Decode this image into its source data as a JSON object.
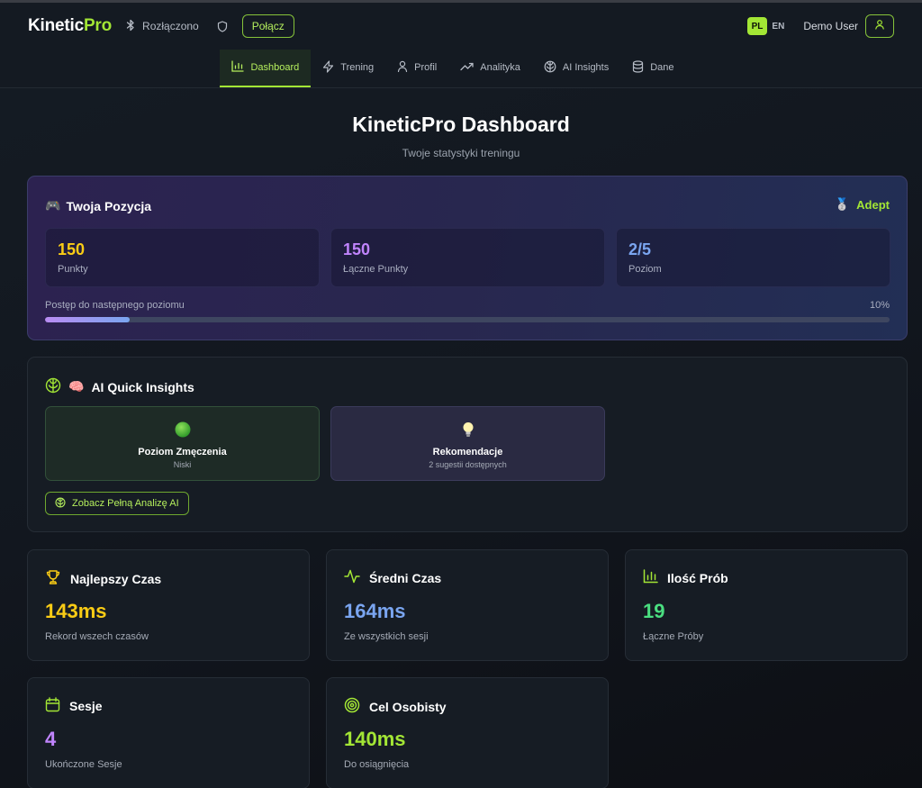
{
  "app": {
    "logo_main": "Kinetic",
    "logo_accent": "Pro"
  },
  "header": {
    "bluetooth_status": "Rozłączono",
    "connect_label": "Połącz",
    "languages": [
      "PL",
      "EN"
    ],
    "active_language": "PL",
    "user_name": "Demo User"
  },
  "nav": {
    "tabs": [
      {
        "label": "Dashboard",
        "icon": "bar-chart-icon",
        "active": true
      },
      {
        "label": "Trening",
        "icon": "lightning-icon"
      },
      {
        "label": "Profil",
        "icon": "user-icon"
      },
      {
        "label": "Analityka",
        "icon": "trend-icon"
      },
      {
        "label": "AI Insights",
        "icon": "brain-icon"
      },
      {
        "label": "Dane",
        "icon": "database-icon"
      }
    ]
  },
  "page": {
    "title": "KineticPro Dashboard",
    "subtitle": "Twoje statystyki treningu"
  },
  "position": {
    "title": "Twoja Pozycja",
    "title_emoji": "🎮",
    "rank_emoji": "🥈",
    "rank": "Adept",
    "stats": [
      {
        "value": "150",
        "label": "Punkty",
        "color": "#facc15"
      },
      {
        "value": "150",
        "label": "Łączne Punkty",
        "color": "#c084fc"
      },
      {
        "value": "2/5",
        "label": "Poziom",
        "color": "#7aa5f0"
      }
    ],
    "progress_label": "Postęp do następnego poziomu",
    "progress_text": "10%",
    "progress_fraction": 0.1
  },
  "ai": {
    "title": "AI Quick Insights",
    "title_emoji": "🧠",
    "fatigue": {
      "title": "Poziom Zmęczenia",
      "value": "Niski",
      "icon": "green-circle-icon"
    },
    "recommendations": {
      "title": "Rekomendacje",
      "value": "2 sugestii dostępnych",
      "icon": "lightbulb-icon"
    },
    "button_label": "Zobacz Pełną Analizę AI"
  },
  "metrics": [
    {
      "title": "Najlepszy Czas",
      "value": "143ms",
      "sub": "Rekord wszech czasów",
      "color": "#facc15",
      "icon": "trophy-icon"
    },
    {
      "title": "Średni Czas",
      "value": "164ms",
      "sub": "Ze wszystkich sesji",
      "color": "#7aa5f0",
      "icon": "activity-icon"
    },
    {
      "title": "Ilość Prób",
      "value": "19",
      "sub": "Łączne Próby",
      "color": "#4ade80",
      "icon": "bar-chart-icon"
    },
    {
      "title": "Sesje",
      "value": "4",
      "sub": "Ukończone Sesje",
      "color": "#c084fc",
      "icon": "calendar-icon"
    },
    {
      "title": "Cel Osobisty",
      "value": "140ms",
      "sub": "Do osiągnięcia",
      "color": "#a3e635",
      "icon": "target-icon"
    }
  ],
  "colors": {
    "accent": "#a3e635",
    "background": "#12171f",
    "card": "#161c24"
  }
}
